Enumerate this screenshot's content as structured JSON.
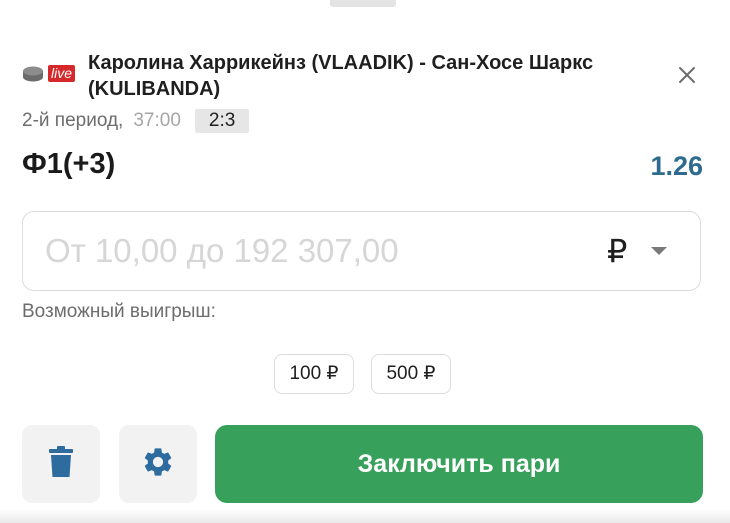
{
  "match": {
    "live_badge": "live",
    "title": "Каролина Харрикейнз (VLAADIK) - Сан-Хосе Шаркс (KULIBANDA)",
    "period": "2-й период,",
    "time": "37:00",
    "score": "2:3"
  },
  "bet": {
    "name": "Ф1(+3)",
    "odds": "1.26"
  },
  "amount": {
    "placeholder": "От 10,00 до 192 307,00",
    "value": "",
    "currency": "₽"
  },
  "possible_win_label": "Возможный выигрыш:",
  "quick_amounts": [
    "100 ₽",
    "500 ₽"
  ],
  "actions": {
    "submit_label": "Заключить пари"
  },
  "icons": {
    "sport": "hockey-puck-icon",
    "close": "close-icon",
    "delete": "trash-icon",
    "settings": "gear-icon",
    "currency_dropdown": "caret-down-icon"
  },
  "colors": {
    "live_badge": "#d5282b",
    "odds": "#2e6b8e",
    "submit_button": "#37a05b",
    "icon_blue": "#2e6b9e"
  }
}
